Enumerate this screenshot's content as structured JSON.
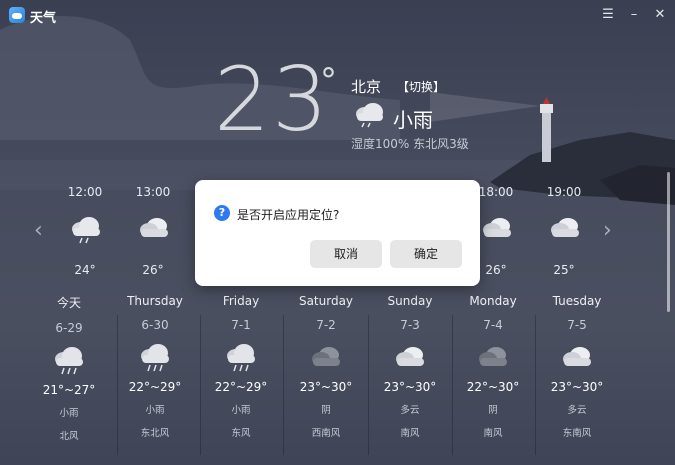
{
  "app": {
    "title": "天气"
  },
  "window_controls": {
    "menu": "☰",
    "minimize": "–",
    "close": "✕"
  },
  "current": {
    "temperature": "23",
    "degree_symbol": "°",
    "city": "北京",
    "switch_label": "【切换】",
    "condition": "小雨",
    "details": "湿度100%  东北风3级"
  },
  "hourly": [
    {
      "time": "12:00",
      "temp": "24°",
      "icon": "rain-cloud-icon"
    },
    {
      "time": "13:00",
      "temp": "26°",
      "icon": "cloud-icon"
    },
    {
      "time": "18:00",
      "temp": "26°",
      "icon": "cloud-icon"
    },
    {
      "time": "19:00",
      "temp": "25°",
      "icon": "cloud-icon"
    }
  ],
  "daily": [
    {
      "name": "今天",
      "date": "6-29",
      "range": "21°~27°",
      "condition": "小雨",
      "wind": "北风",
      "icon": "rain-cloud-icon"
    },
    {
      "name": "Thursday",
      "date": "6-30",
      "range": "22°~29°",
      "condition": "小雨",
      "wind": "东北风",
      "icon": "rain-cloud-icon"
    },
    {
      "name": "Friday",
      "date": "7-1",
      "range": "22°~29°",
      "condition": "小雨",
      "wind": "东风",
      "icon": "rain-cloud-icon"
    },
    {
      "name": "Saturday",
      "date": "7-2",
      "range": "23°~30°",
      "condition": "阴",
      "wind": "西南风",
      "icon": "overcast-icon"
    },
    {
      "name": "Sunday",
      "date": "7-3",
      "range": "23°~30°",
      "condition": "多云",
      "wind": "南风",
      "icon": "cloud-icon"
    },
    {
      "name": "Monday",
      "date": "7-4",
      "range": "22°~30°",
      "condition": "阴",
      "wind": "南风",
      "icon": "overcast-icon"
    },
    {
      "name": "Tuesday",
      "date": "7-5",
      "range": "23°~30°",
      "condition": "多云",
      "wind": "东南风",
      "icon": "cloud-icon"
    }
  ],
  "nav": {
    "prev": "‹",
    "next": "›"
  },
  "dialog": {
    "icon": "?",
    "message": "是否开启应用定位?",
    "cancel_label": "取消",
    "confirm_label": "确定"
  }
}
